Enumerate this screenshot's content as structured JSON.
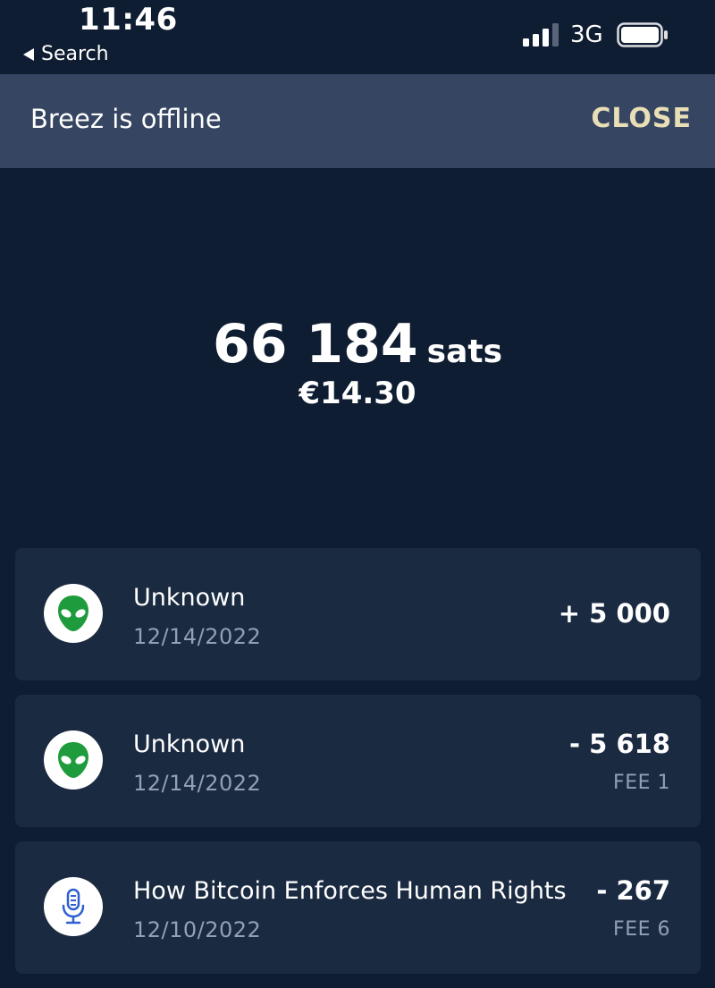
{
  "status_bar": {
    "time": "11:46",
    "back_label": "Search",
    "network": "3G",
    "icons": [
      "back-arrow-icon",
      "signal-bars-icon",
      "battery-icon"
    ]
  },
  "banner": {
    "text": "Breez is offline",
    "close_label": "CLOSE",
    "close_color": "#e9dfb6",
    "background": "#364561"
  },
  "balance": {
    "amount": "66 184",
    "unit": "sats",
    "fiat": "€14.30"
  },
  "transactions": [
    {
      "title": "Unknown",
      "date": "12/14/2022",
      "amount": "+ 5 000",
      "fee": "",
      "icon": "alien-icon"
    },
    {
      "title": "Unknown",
      "date": "12/14/2022",
      "amount": "- 5 618",
      "fee": "FEE 1",
      "icon": "alien-icon"
    },
    {
      "title": "How Bitcoin Enforces Human Rights",
      "date": "12/10/2022",
      "amount": "- 267",
      "fee": "FEE 6",
      "icon": "microphone-icon"
    }
  ],
  "colors": {
    "background": "#0f1d32",
    "card": "#1a2a41",
    "secondary_text": "#93a0b4",
    "alien_green": "#1e9b3c",
    "mic_blue": "#2f5fd0"
  }
}
